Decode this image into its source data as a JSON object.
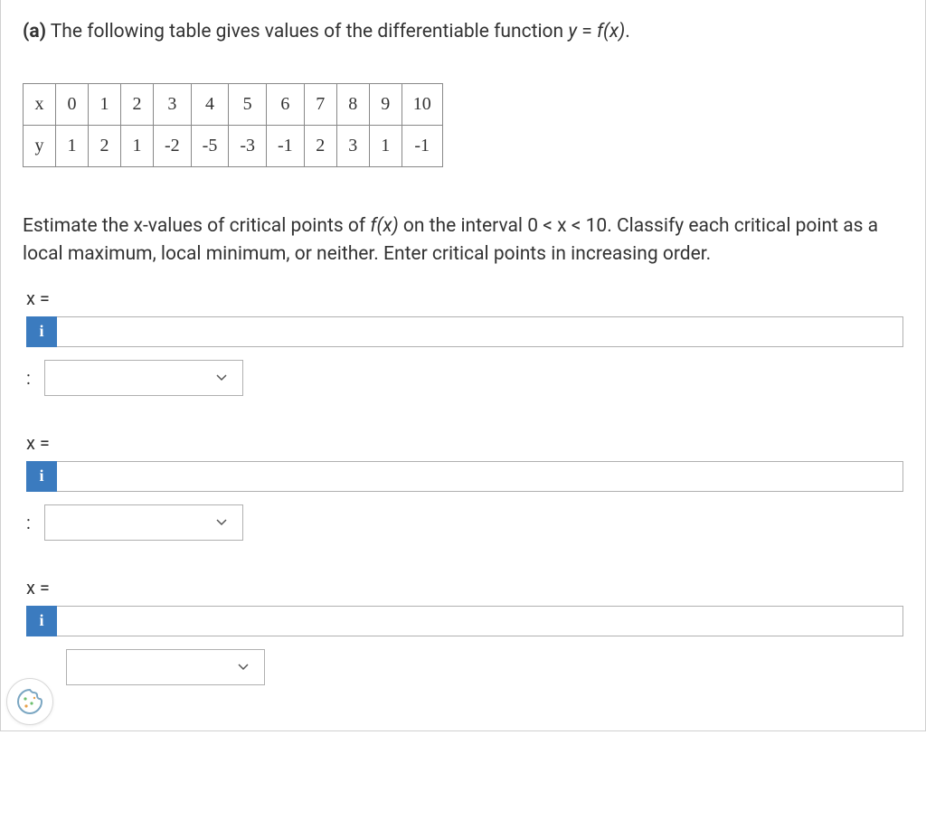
{
  "part_label": "(a)",
  "prompt_before_y": " The following table gives values of the differentiable function ",
  "prompt_y": "y",
  "prompt_eq": " = ",
  "prompt_fx": "f(x)",
  "prompt_after": ".",
  "chart_data": {
    "type": "table",
    "headers": [
      "x",
      "y"
    ],
    "rows": [
      [
        "x",
        0,
        1,
        2,
        3,
        4,
        5,
        6,
        7,
        8,
        9,
        10
      ],
      [
        "y",
        1,
        2,
        1,
        -2,
        -5,
        -3,
        -1,
        2,
        3,
        1,
        -1
      ]
    ]
  },
  "instructions_before": "Estimate the x-values of critical points of ",
  "instructions_fx": "f(x)",
  "instructions_after": " on the interval 0 < x < 10. Classify each critical point as a local maximum, local minimum, or neither. Enter critical points in increasing order.",
  "x_equals_label": "x =",
  "info_icon": "i",
  "colon": ":",
  "cookie_tooltip": "Cookie preferences"
}
